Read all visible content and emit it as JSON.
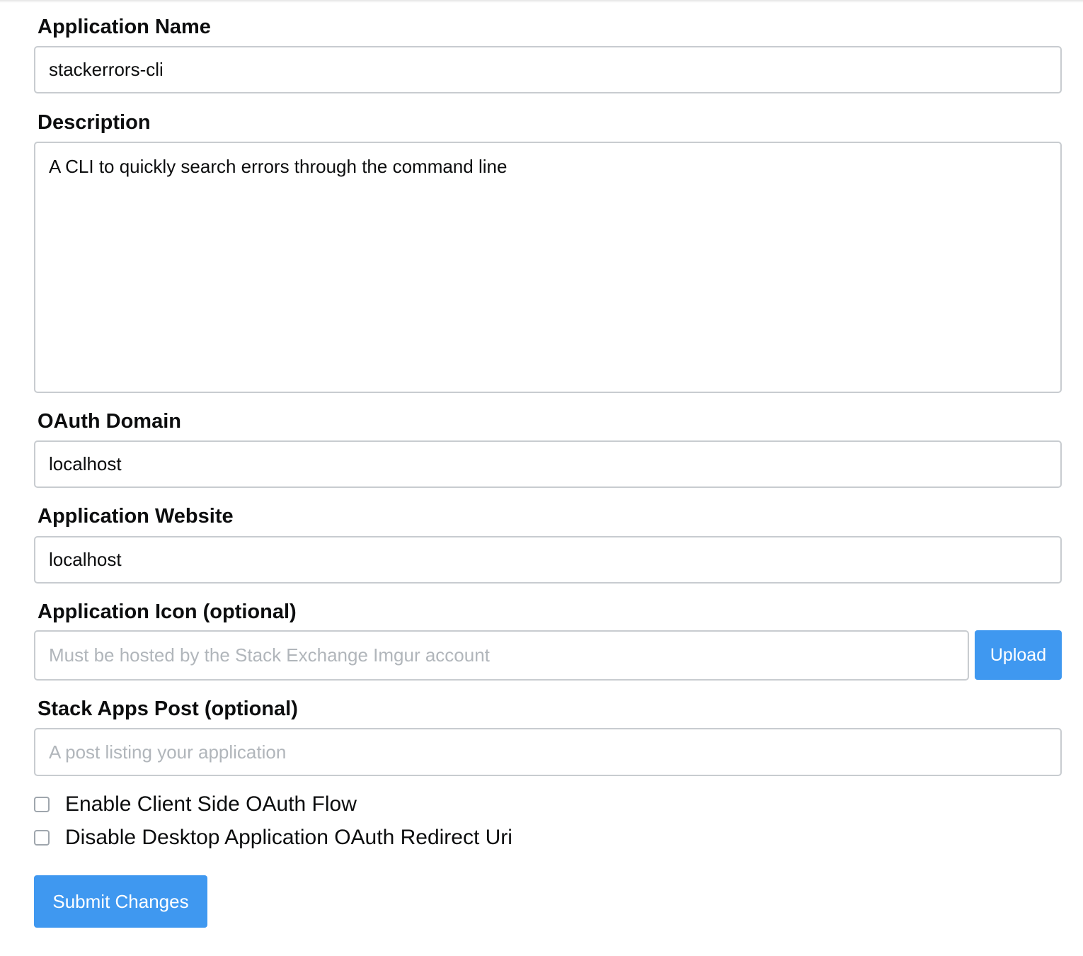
{
  "form": {
    "app_name": {
      "label": "Application Name",
      "value": "stackerrors-cli"
    },
    "description": {
      "label": "Description",
      "value": "A CLI to quickly search errors through the command line"
    },
    "oauth_domain": {
      "label": "OAuth Domain",
      "value": "localhost"
    },
    "website": {
      "label": "Application Website",
      "value": "localhost"
    },
    "icon": {
      "label": "Application Icon (optional)",
      "value": "",
      "placeholder": "Must be hosted by the Stack Exchange Imgur account",
      "upload_label": "Upload"
    },
    "stack_apps_post": {
      "label": "Stack Apps Post (optional)",
      "value": "",
      "placeholder": "A post listing your application"
    },
    "checkboxes": [
      {
        "label": "Enable Client Side OAuth Flow",
        "checked": false
      },
      {
        "label": "Disable Desktop Application OAuth Redirect Uri",
        "checked": false
      }
    ],
    "submit_label": "Submit Changes"
  },
  "colors": {
    "primary_button": "#3f98f0",
    "input_border": "#c8ccd0",
    "placeholder_text": "#b1b6bb",
    "text": "#0c0d0e"
  }
}
